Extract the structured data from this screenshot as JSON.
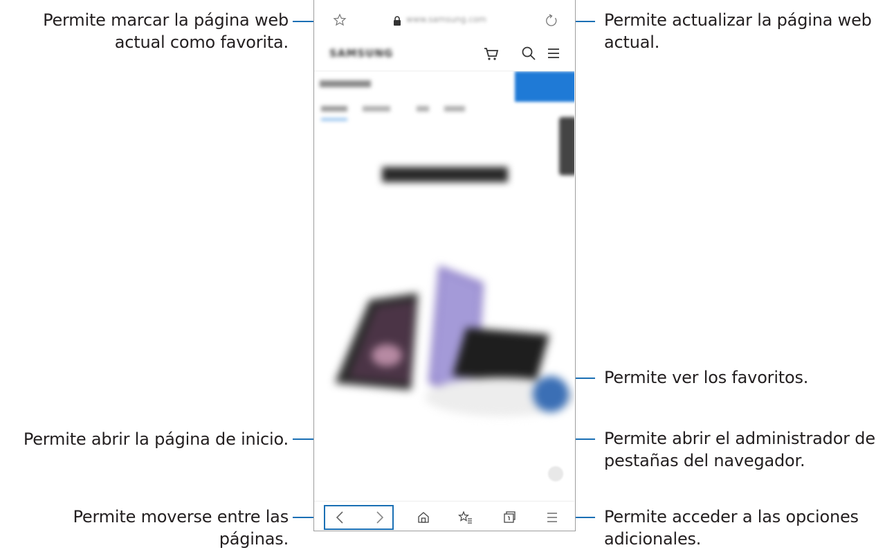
{
  "callouts": {
    "bookmark_add": [
      "Permite marcar la página web",
      "actual como favorita."
    ],
    "refresh": [
      "Permite actualizar la página web",
      "actual."
    ],
    "bookmarks": "Permite ver los favoritos.",
    "home": "Permite abrir la página de inicio.",
    "tabs": [
      "Permite abrir el administrador de",
      "pestañas del navegador."
    ],
    "navigate": "Permite moverse entre las páginas.",
    "options": [
      "Permite acceder a las opciones",
      "adicionales."
    ]
  },
  "browser": {
    "address_bar": {
      "url_text": "www.samsung.com",
      "icons": [
        "star-outline-icon",
        "lock-icon",
        "refresh-icon"
      ]
    },
    "site_header": {
      "logo_text": "SAMSUNG",
      "icons": [
        "cart-icon",
        "search-icon",
        "menu-icon"
      ]
    },
    "bottom_toolbar": {
      "icons": [
        "back-icon",
        "forward-icon",
        "home-icon",
        "bookmarks-icon",
        "tabs-icon",
        "more-options-icon"
      ]
    }
  },
  "colors": {
    "leader": "#1a6fb4",
    "text": "#231f20",
    "frame": "#9d9d9d"
  }
}
